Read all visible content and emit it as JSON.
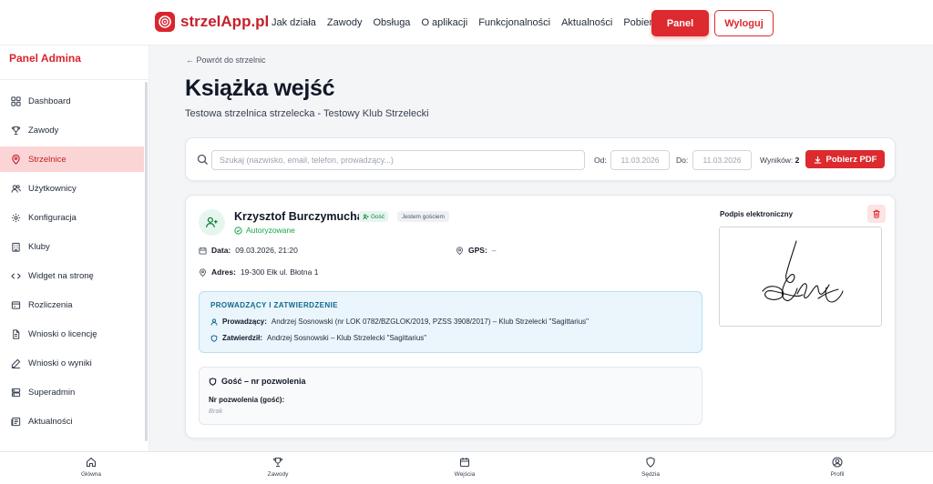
{
  "header": {
    "logo_text": "strzelApp.pl",
    "nav": [
      "Jak działa",
      "Zawody",
      "Obsługa",
      "O aplikacji",
      "Funkcjonalności",
      "Aktualności",
      "Pobierz"
    ],
    "panel_button": "Panel",
    "logout_button": "Wyloguj"
  },
  "sidebar": {
    "title": "Panel Admina",
    "items": [
      {
        "label": "Dashboard",
        "icon": "dashboard-icon"
      },
      {
        "label": "Zawody",
        "icon": "trophy-icon"
      },
      {
        "label": "Strzelnice",
        "icon": "map-pin-icon",
        "active": true
      },
      {
        "label": "Użytkownicy",
        "icon": "users-icon"
      },
      {
        "label": "Konfiguracja",
        "icon": "gear-icon"
      },
      {
        "label": "Kluby",
        "icon": "building-icon"
      },
      {
        "label": "Widget na stronę",
        "icon": "code-icon"
      },
      {
        "label": "Rozliczenia",
        "icon": "receipt-icon"
      },
      {
        "label": "Wnioski o licencję",
        "icon": "file-icon"
      },
      {
        "label": "Wnioski o wyniki",
        "icon": "pen-icon"
      },
      {
        "label": "Superadmin",
        "icon": "server-icon"
      },
      {
        "label": "Aktualności",
        "icon": "newspaper-icon"
      }
    ]
  },
  "page": {
    "back_link": "Powrót do strzelnic",
    "title": "Książka wejść",
    "subtitle": "Testowa strzelnica strzelecka - Testowy Klub Strzelecki"
  },
  "filters": {
    "search_placeholder": "Szukaj (nazwisko, email, telefon, prowadzący...)",
    "from_label": "Od:",
    "from_value": "11.03.2026",
    "to_label": "Do:",
    "to_value": "11.03.2026",
    "results_label": "Wyników:",
    "results_count": "2",
    "pdf_button": "Pobierz PDF"
  },
  "entry": {
    "name": "Krzysztof Burczymucha",
    "badge_guest": "Gość",
    "badge_self": "Jestem gościem",
    "status": "Autoryzowane",
    "date_label": "Data:",
    "date_value": "09.03.2026, 21:20",
    "gps_label": "GPS:",
    "gps_value": "–",
    "address_label": "Adres:",
    "address_value": "19-300 Ełk ul. Błotna 1",
    "supervisor_section": "PROWADZĄCY I ZATWIERDZENIE",
    "supervisor_label": "Prowadzący:",
    "supervisor_value": "Andrzej Sosnowski (nr LOK 0782/BZGLOK/2019, PZSS 3908/2017) – Klub Strzelecki \"Sagittarius\"",
    "approved_label": "Zatwierdził:",
    "approved_value": "Andrzej Sosnowski – Klub Strzelecki \"Sagittarius\"",
    "permit_section": "Gość – nr pozwolenia",
    "permit_label": "Nr pozwolenia (gość):",
    "permit_value": "Brak",
    "signature_label": "Podpis elektroniczny"
  },
  "bottom_nav": [
    {
      "label": "Główna",
      "icon": "home-icon"
    },
    {
      "label": "Zawody",
      "icon": "trophy-icon"
    },
    {
      "label": "Wejścia",
      "icon": "calendar-icon"
    },
    {
      "label": "Sędzia",
      "icon": "shield-icon"
    },
    {
      "label": "Profil",
      "icon": "user-circle-icon"
    }
  ],
  "colors": {
    "accent": "#dc2a2f",
    "active_bg": "#fbd5d5",
    "success": "#16a34a",
    "info_bg": "#eaf5fc"
  }
}
